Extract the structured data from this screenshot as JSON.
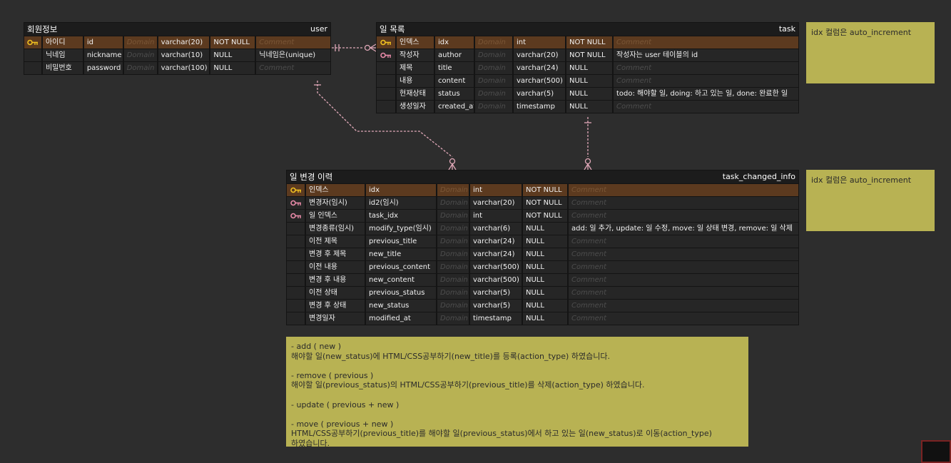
{
  "colors": {
    "background": "#2d2d2d",
    "table_bg": "#1c1c1c",
    "pk_row": "#5c3a1f",
    "memo": "#b8b253",
    "relation_line": "#e0a8b8",
    "pk_key": "#f0c020",
    "fk_key": "#e88aa8"
  },
  "tables": {
    "user": {
      "logical_name": "회원정보",
      "physical_name": "user",
      "rows": [
        {
          "key": "pk-key-icon",
          "logical": "아이디",
          "physical": "id",
          "domain": "Domain",
          "type": "varchar(20)",
          "nullable": "NOT NULL",
          "comment": "Comment",
          "comment_set": false
        },
        {
          "key": "",
          "logical": "닉네임",
          "physical": "nickname",
          "domain": "Domain",
          "type": "varchar(10)",
          "nullable": "NULL",
          "comment": "닉네임은(unique)",
          "comment_set": true
        },
        {
          "key": "",
          "logical": "비밀번호",
          "physical": "password",
          "domain": "Domain",
          "type": "varchar(100)",
          "nullable": "NULL",
          "comment": "Comment",
          "comment_set": false
        }
      ]
    },
    "task": {
      "logical_name": "일 목록",
      "physical_name": "task",
      "rows": [
        {
          "key": "pk-key-icon",
          "logical": "인덱스",
          "physical": "idx",
          "domain": "Domain",
          "type": "int",
          "nullable": "NOT NULL",
          "comment": "Comment",
          "comment_set": false
        },
        {
          "key": "fk-key-icon",
          "logical": "작성자",
          "physical": "author",
          "domain": "Domain",
          "type": "varchar(20)",
          "nullable": "NOT NULL",
          "comment": "작성자는 user 테이블의 id",
          "comment_set": true
        },
        {
          "key": "",
          "logical": "제목",
          "physical": "title",
          "domain": "Domain",
          "type": "varchar(24)",
          "nullable": "NULL",
          "comment": "Comment",
          "comment_set": false
        },
        {
          "key": "",
          "logical": "내용",
          "physical": "content",
          "domain": "Domain",
          "type": "varchar(500)",
          "nullable": "NULL",
          "comment": "Comment",
          "comment_set": false
        },
        {
          "key": "",
          "logical": "현재상태",
          "physical": "status",
          "domain": "Domain",
          "type": "varchar(5)",
          "nullable": "NULL",
          "comment": "todo: 해야할 일, doing: 하고 있는 일, done: 완료한 일",
          "comment_set": true
        },
        {
          "key": "",
          "logical": "생성일자",
          "physical": "created_at",
          "domain": "Domain",
          "type": "timestamp",
          "nullable": "NULL",
          "comment": "Comment",
          "comment_set": false
        }
      ]
    },
    "task_changed_info": {
      "logical_name": "일 변경 이력",
      "physical_name": "task_changed_info",
      "rows": [
        {
          "key": "pk-key-icon",
          "logical": "인덱스",
          "physical": "idx",
          "domain": "Domain",
          "type": "int",
          "nullable": "NOT NULL",
          "comment": "Comment",
          "comment_set": false
        },
        {
          "key": "fk-key-icon",
          "logical": "변경자(임시)",
          "physical": "id2(임시)",
          "domain": "Domain",
          "type": "varchar(20)",
          "nullable": "NOT NULL",
          "comment": "Comment",
          "comment_set": false
        },
        {
          "key": "fk-key-icon",
          "logical": "일 인덱스",
          "physical": "task_idx",
          "domain": "Domain",
          "type": "int",
          "nullable": "NOT NULL",
          "comment": "Comment",
          "comment_set": false
        },
        {
          "key": "",
          "logical": "변경종류(임시)",
          "physical": "modify_type(임시)",
          "domain": "Domain",
          "type": "varchar(6)",
          "nullable": "NULL",
          "comment": "add: 일 추가, update: 일 수정, move: 일 상태 변경, remove: 일 삭제",
          "comment_set": true
        },
        {
          "key": "",
          "logical": "이전 제목",
          "physical": "previous_title",
          "domain": "Domain",
          "type": "varchar(24)",
          "nullable": "NULL",
          "comment": "Comment",
          "comment_set": false
        },
        {
          "key": "",
          "logical": "변경 후 제목",
          "physical": "new_title",
          "domain": "Domain",
          "type": "varchar(24)",
          "nullable": "NULL",
          "comment": "Comment",
          "comment_set": false
        },
        {
          "key": "",
          "logical": "이전 내용",
          "physical": "previous_content",
          "domain": "Domain",
          "type": "varchar(500)",
          "nullable": "NULL",
          "comment": "Comment",
          "comment_set": false
        },
        {
          "key": "",
          "logical": "변경 후 내용",
          "physical": "new_content",
          "domain": "Domain",
          "type": "varchar(500)",
          "nullable": "NULL",
          "comment": "Comment",
          "comment_set": false
        },
        {
          "key": "",
          "logical": "이전 상태",
          "physical": "previous_status",
          "domain": "Domain",
          "type": "varchar(5)",
          "nullable": "NULL",
          "comment": "Comment",
          "comment_set": false
        },
        {
          "key": "",
          "logical": "변경 후 상태",
          "physical": "new_status",
          "domain": "Domain",
          "type": "varchar(5)",
          "nullable": "NULL",
          "comment": "Comment",
          "comment_set": false
        },
        {
          "key": "",
          "logical": "변경일자",
          "physical": "modified_at",
          "domain": "Domain",
          "type": "timestamp",
          "nullable": "NULL",
          "comment": "Comment",
          "comment_set": false
        }
      ]
    }
  },
  "memos": {
    "task_idx_note": "idx 컬럼은 auto_increment",
    "history_idx_note": "idx 컬럼은 auto_increment",
    "action_notes": [
      "- add ( new )",
      "해야할 일(new_status)에 HTML/CSS공부하기(new_title)를 등록(action_type) 하였습니다.",
      "",
      "- remove ( previous )",
      "해야할 일(previous_status)의 HTML/CSS공부하기(previous_title)를 삭제(action_type) 하였습니다.",
      "",
      "- update ( previous + new )",
      "",
      "- move ( previous + new )",
      "HTML/CSS공부하기(previous_title)를 해야할 일(previous_status)에서 하고 있는 일(new_status)로 이동(action_type)",
      "하였습니다."
    ]
  }
}
